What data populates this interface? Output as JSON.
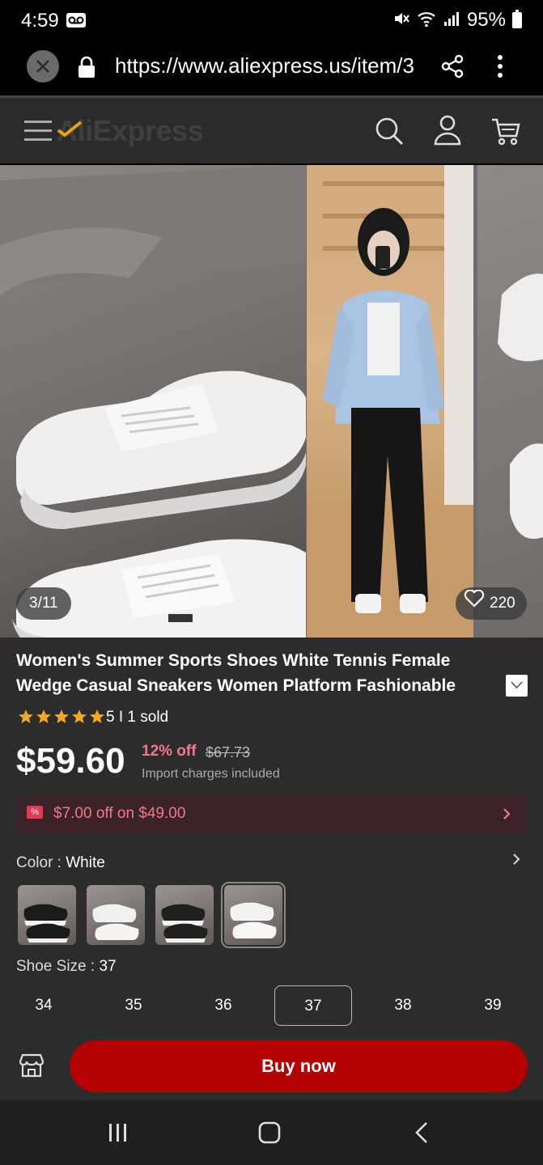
{
  "status_bar": {
    "time": "4:59",
    "battery": "95%"
  },
  "browser": {
    "url": "https://www.aliexpress.us/item/3"
  },
  "header": {
    "logo": "AliExpress"
  },
  "gallery": {
    "counter": "3/11",
    "likes": "220"
  },
  "product": {
    "title": "Women's Summer Sports Shoes White Tennis Female Wedge Casual Sneakers Women Platform Fashionable",
    "rating_stars": 5,
    "sold": "5 I 1 sold",
    "price": "$59.60",
    "discount": "12% off",
    "old_price": "$67.73",
    "import_note": "Import charges included",
    "coupon": "$7.00 off on $49.00",
    "coupon_tag": "%",
    "color_label": "Color : ",
    "color_value": "White",
    "size_label": "Shoe Size : ",
    "size_value": "37",
    "sizes": [
      "34",
      "35",
      "36",
      "37",
      "38",
      "39"
    ],
    "selected_size_index": 3,
    "selected_color_index": 3
  },
  "actions": {
    "buy_now": "Buy now"
  },
  "colors": {
    "accent_red": "#b30000",
    "pink": "#f2778e",
    "star": "#f5a623"
  }
}
